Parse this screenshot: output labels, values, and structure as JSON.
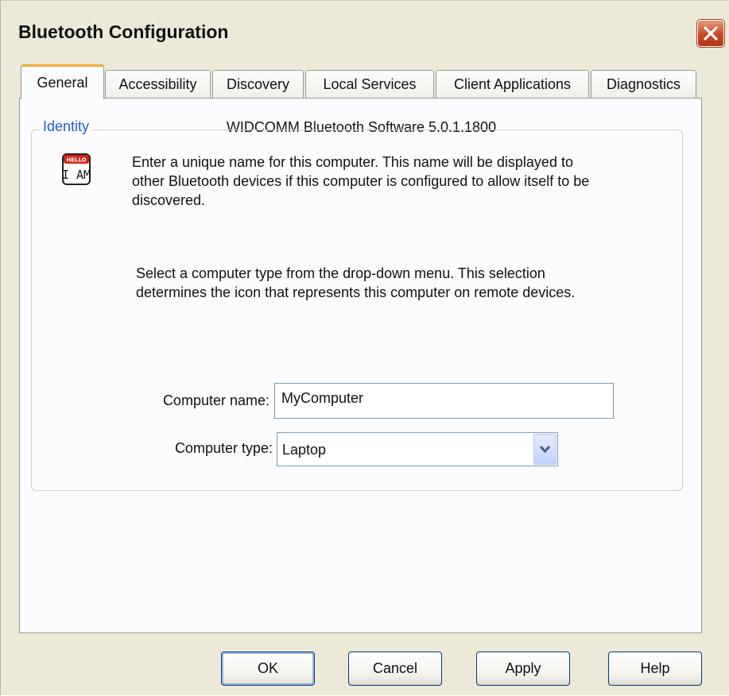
{
  "window": {
    "title": "Bluetooth Configuration"
  },
  "tabs": [
    {
      "label": "General",
      "active": true
    },
    {
      "label": "Accessibility",
      "active": false
    },
    {
      "label": "Discovery",
      "active": false
    },
    {
      "label": "Local Services",
      "active": false
    },
    {
      "label": "Client Applications",
      "active": false
    },
    {
      "label": "Diagnostics",
      "active": false
    }
  ],
  "general": {
    "version_text": "WIDCOMM Bluetooth Software 5.0.1.1800",
    "identity": {
      "legend": "Identity",
      "icon_badge": "HELLO",
      "icon_text": "I AM",
      "description_line1": "Enter a unique name for this computer.  This name will be displayed to",
      "description_line2": "other Bluetooth devices if this computer is configured to allow itself to be",
      "description_line3": "discovered.",
      "type_help_line1": "Select a computer type from the drop-down menu.  This selection",
      "type_help_line2": "determines the icon that represents this computer on remote devices.",
      "computer_name_label": "Computer name:",
      "computer_name_value": "MyComputer",
      "computer_type_label": "Computer type:",
      "computer_type_value": "Laptop"
    }
  },
  "buttons": {
    "ok": "OK",
    "cancel": "Cancel",
    "apply": "Apply",
    "help": "Help"
  },
  "colors": {
    "dialog_background": "#ece9d8",
    "active_tab_accent": "#f1a73b",
    "group_legend": "#1f5fd0",
    "close_button": "#c44a24"
  }
}
